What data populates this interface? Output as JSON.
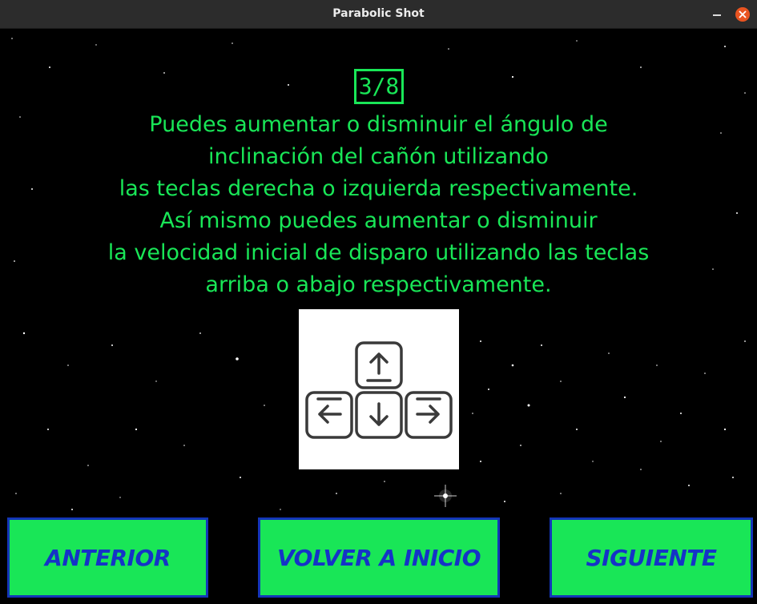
{
  "window": {
    "title": "Parabolic Shot"
  },
  "colors": {
    "text_green": "#19e657",
    "button_bg": "#19e657",
    "button_text": "#1533c7",
    "button_border": "#1436b8",
    "close_button": "#e95420"
  },
  "slide": {
    "counter": "3/8",
    "lines": [
      "Puedes aumentar o disminuir el ángulo de",
      "inclinación del cañón utilizando",
      "las teclas derecha o izquierda respectivamente.",
      "Así mismo puedes aumentar o disminuir",
      "la velocidad inicial de disparo utilizando las teclas",
      "arriba o abajo respectivamente."
    ],
    "keys_icons": [
      "arrow-up-key-icon",
      "arrow-left-key-icon",
      "arrow-down-key-icon",
      "arrow-right-key-icon"
    ]
  },
  "buttons": {
    "prev": "ANTERIOR",
    "home": "VOLVER A INICIO",
    "next": "SIGUIENTE"
  }
}
